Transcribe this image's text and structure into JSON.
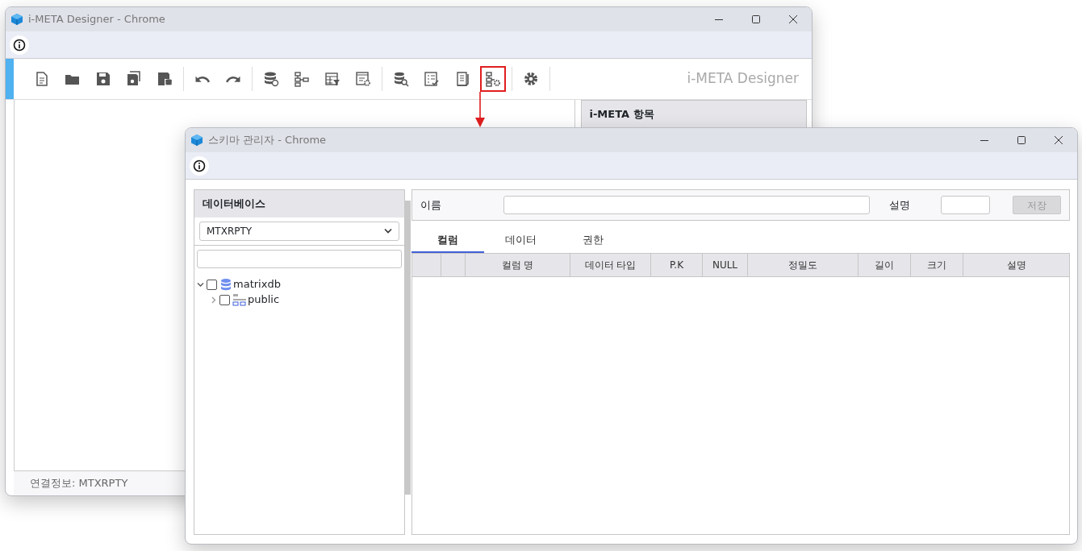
{
  "main_window": {
    "title": "i-META Designer - Chrome",
    "toolbar": [
      {
        "kind": "button",
        "highlighted": false
      },
      {
        "kind": "button",
        "highlighted": false
      },
      {
        "kind": "button",
        "highlighted": false
      },
      {
        "kind": "button",
        "highlighted": false
      },
      {
        "kind": "button",
        "highlighted": false
      },
      {
        "kind": "separator"
      },
      {
        "kind": "button",
        "highlighted": false
      },
      {
        "kind": "button",
        "highlighted": false
      },
      {
        "kind": "separator"
      },
      {
        "kind": "button",
        "highlighted": false
      },
      {
        "kind": "button",
        "highlighted": false
      },
      {
        "kind": "button",
        "highlighted": false
      },
      {
        "kind": "button",
        "highlighted": false
      },
      {
        "kind": "separator"
      },
      {
        "kind": "button",
        "highlighted": false
      },
      {
        "kind": "button",
        "highlighted": false
      },
      {
        "kind": "button",
        "highlighted": false
      },
      {
        "kind": "button",
        "highlighted": true
      },
      {
        "kind": "separator"
      },
      {
        "kind": "button",
        "highlighted": false
      },
      {
        "kind": "separator"
      }
    ],
    "brand": "i-META Designer",
    "side_panel_title": "i-META 항목",
    "status": "연결정보: MTXRPTY"
  },
  "schema_window": {
    "title": "스키마 관리자 - Chrome",
    "database_panel": {
      "title": "데이터베이스",
      "selected_database": "MTXRPTY",
      "tree": [
        {
          "label": "matrixdb",
          "kind": "database",
          "expanded": true,
          "checked": false,
          "children": [
            {
              "label": "public",
              "kind": "schema",
              "expanded": false,
              "checked": false
            }
          ]
        }
      ]
    },
    "form": {
      "name_label": "이름",
      "description_label": "설명",
      "save_button": {
        "label": "저장",
        "disabled": true
      }
    },
    "tabs": [
      {
        "label": "컬럼",
        "selected": true
      },
      {
        "label": "데이터",
        "selected": false
      },
      {
        "label": "권한",
        "selected": false
      }
    ],
    "table": {
      "columns": [
        "컬럼 명",
        "데이터 타입",
        "P.K",
        "NULL",
        "정밀도",
        "길이",
        "크기",
        "설명"
      ]
    }
  }
}
